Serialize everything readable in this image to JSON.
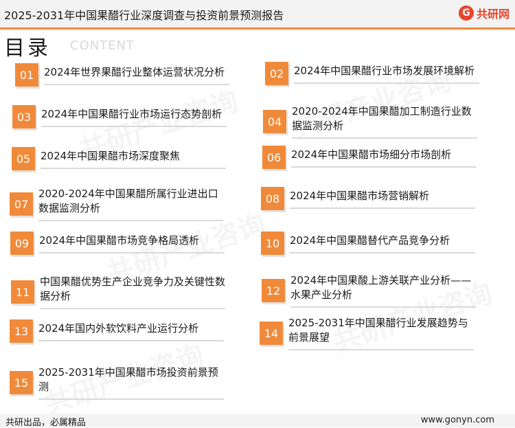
{
  "header": {
    "title": "2025-2031年中国果醋行业深度调查与投资前景预测报告",
    "logo_mark": "G",
    "logo_text": "共研网"
  },
  "section": {
    "title": "目录",
    "subtitle": "CONTENT"
  },
  "watermark": "共研产业咨询",
  "toc": [
    {
      "num": "01",
      "label": "2024年世界果醋行业整体运营状况分析"
    },
    {
      "num": "02",
      "label": "2024年中国果醋行业市场发展环境解析"
    },
    {
      "num": "03",
      "label": "2024年中国果醋行业市场运行态势剖析"
    },
    {
      "num": "04",
      "label": "2020-2024年中国果醋加工制造行业数据监测分析"
    },
    {
      "num": "05",
      "label": "2024年中国果醋市场深度聚焦"
    },
    {
      "num": "06",
      "label": "2024年中国果醋市场细分市场剖析"
    },
    {
      "num": "07",
      "label": "2020-2024年中国果醋所属行业进出口数据监测分析"
    },
    {
      "num": "08",
      "label": "2024年中国果醋市场营销解析"
    },
    {
      "num": "09",
      "label": "2024年中国果醋市场竞争格局透析"
    },
    {
      "num": "10",
      "label": "2024年中国果醋替代产品竞争分析"
    },
    {
      "num": "11",
      "label": "中国果醋优势生产企业竞争力及关键性数据分析"
    },
    {
      "num": "12",
      "label": "2024年中国果酸上游关联产业分析——水果产业分析"
    },
    {
      "num": "13",
      "label": "2024年国内外软饮料产业运行分析"
    },
    {
      "num": "14",
      "label": "2025-2031年中国果醋行业发展趋势与前景展望"
    },
    {
      "num": "15",
      "label": "2025-2031年中国果醋市场投资前景预测"
    }
  ],
  "footer": {
    "left": "共研出品，必属精品",
    "right": "www.gonyn.com"
  },
  "colors": {
    "accent": "#f08a3a",
    "logo": "#e8452c"
  }
}
